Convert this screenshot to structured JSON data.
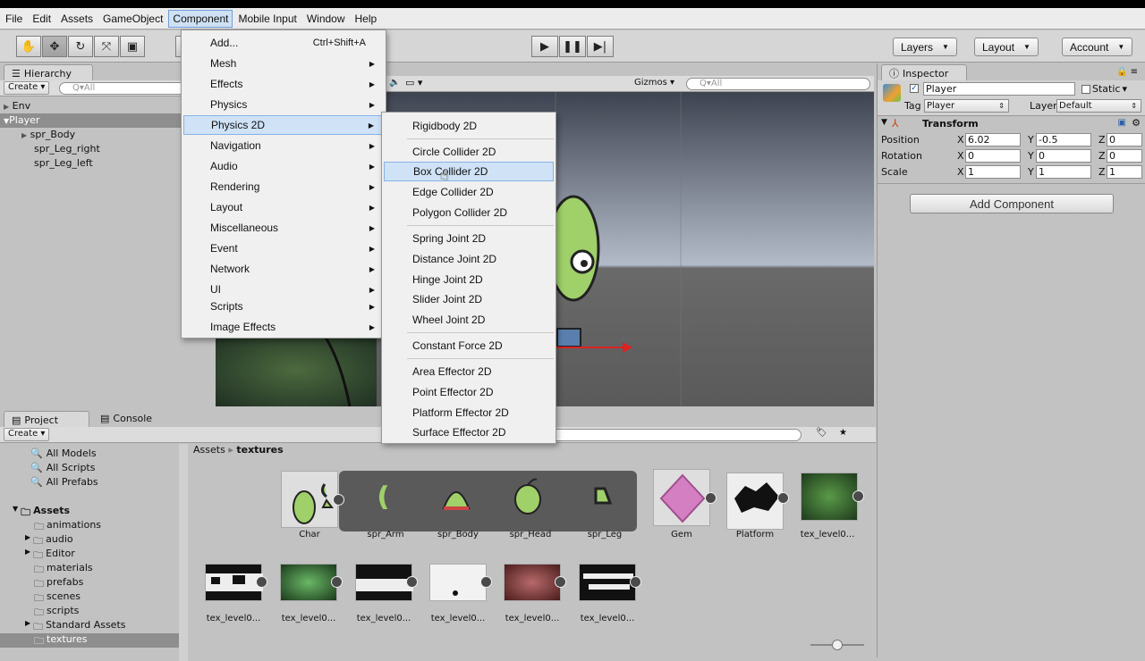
{
  "menubar": {
    "items": [
      "File",
      "Edit",
      "Assets",
      "GameObject",
      "Component",
      "Mobile Input",
      "Window",
      "Help"
    ],
    "active": "Component"
  },
  "toolbar": {
    "layers": "Layers",
    "layout": "Layout",
    "account": "Account"
  },
  "hierarchy": {
    "tab": "Hierarchy",
    "create": "Create",
    "search_placeholder": "Q▾All",
    "items": [
      "Env",
      "Player",
      "spr_Body",
      "spr_Leg_right",
      "spr_Leg_left"
    ]
  },
  "scene": {
    "gizmos": "Gizmos",
    "search_placeholder": "Q▾All"
  },
  "component_menu": {
    "items": [
      {
        "label": "Add...",
        "shortcut": "Ctrl+Shift+A"
      },
      {
        "label": "Mesh"
      },
      {
        "label": "Effects"
      },
      {
        "label": "Physics"
      },
      {
        "label": "Physics 2D"
      },
      {
        "label": "Navigation"
      },
      {
        "label": "Audio"
      },
      {
        "label": "Rendering"
      },
      {
        "label": "Layout"
      },
      {
        "label": "Miscellaneous"
      },
      {
        "label": "Event"
      },
      {
        "label": "Network"
      },
      {
        "label": "UI"
      },
      {
        "label": "Scripts"
      },
      {
        "label": "Image Effects"
      }
    ]
  },
  "physics2d_menu": {
    "items": [
      "Rigidbody 2D",
      "Circle Collider 2D",
      "Box Collider 2D",
      "Edge Collider 2D",
      "Polygon Collider 2D",
      "Spring Joint 2D",
      "Distance Joint 2D",
      "Hinge Joint 2D",
      "Slider Joint 2D",
      "Wheel Joint 2D",
      "Constant Force 2D",
      "Area Effector 2D",
      "Point Effector 2D",
      "Platform Effector 2D",
      "Surface Effector 2D"
    ],
    "highlighted": "Box Collider 2D"
  },
  "inspector": {
    "tab": "Inspector",
    "object_name": "Player",
    "static_label": "Static",
    "tag_label": "Tag",
    "tag_value": "Player",
    "layer_label": "Layer",
    "layer_value": "Default",
    "transform_title": "Transform",
    "position_label": "Position",
    "rotation_label": "Rotation",
    "scale_label": "Scale",
    "position": {
      "x": "6.02",
      "y": "-0.5",
      "z": "0"
    },
    "rotation": {
      "x": "0",
      "y": "0",
      "z": "0"
    },
    "scale": {
      "x": "1",
      "y": "1",
      "z": "1"
    },
    "add_component": "Add Component"
  },
  "project": {
    "tab_project": "Project",
    "tab_console": "Console",
    "create": "Create",
    "favorites": [
      "All Models",
      "All Scripts",
      "All Prefabs"
    ],
    "assets_root": "Assets",
    "folders": [
      "animations",
      "audio",
      "Editor",
      "materials",
      "prefabs",
      "scenes",
      "scripts",
      "Standard Assets",
      "textures"
    ],
    "breadcrumb_root": "Assets",
    "breadcrumb_current": "textures",
    "row1": [
      "Char",
      "spr_Arm",
      "spr_Body",
      "spr_Head",
      "spr_Leg",
      "Gem",
      "Platform",
      "tex_level0..."
    ],
    "row2": [
      "tex_level0...",
      "tex_level0...",
      "tex_level0...",
      "tex_level0...",
      "tex_level0...",
      "tex_level0..."
    ]
  },
  "colors": {
    "menu_highlight": "#cfe2f6",
    "selection": "#8e8e8e",
    "scene_bg": "#5c5d5f"
  }
}
